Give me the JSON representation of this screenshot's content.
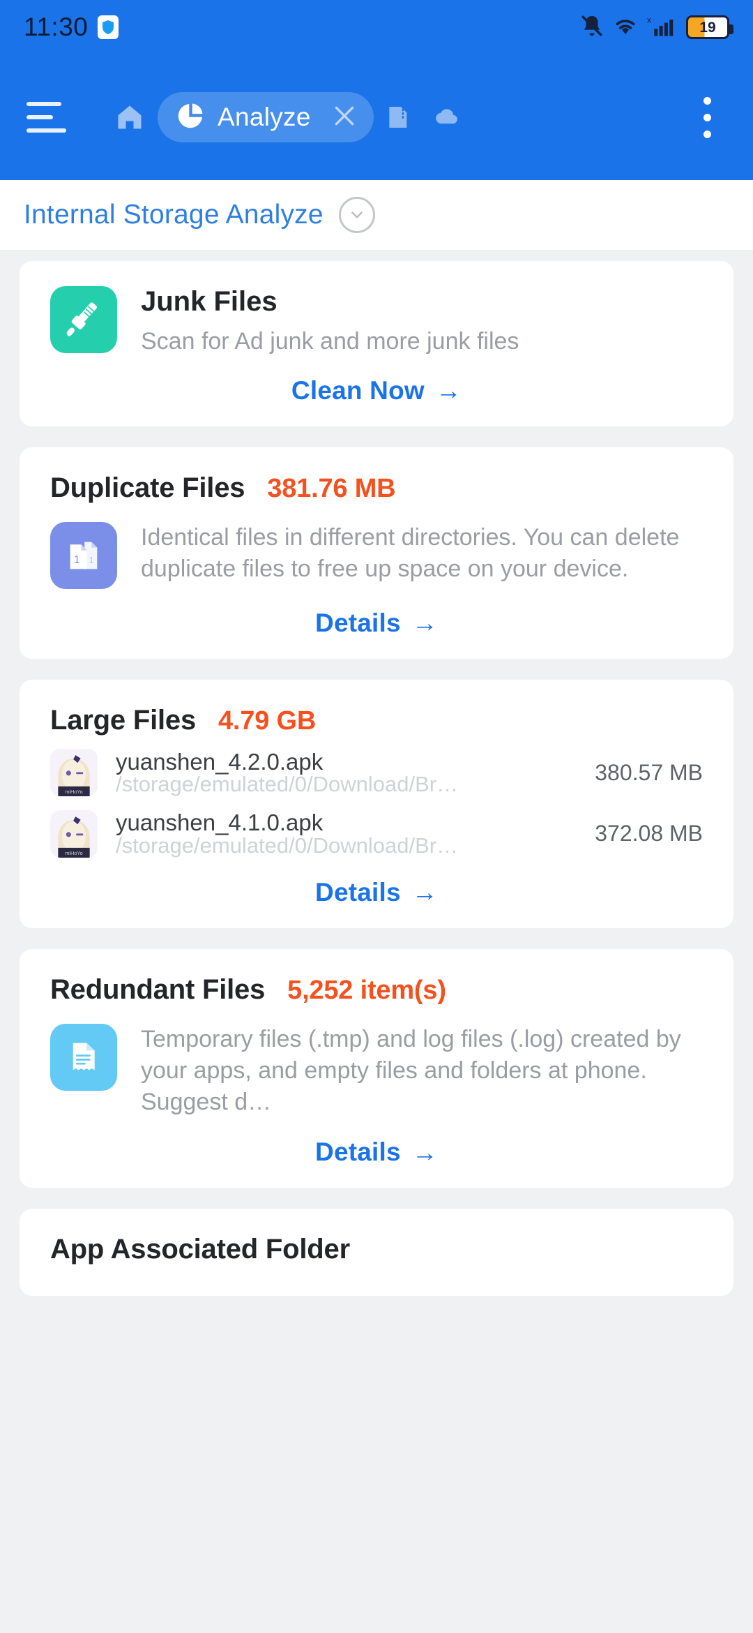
{
  "status_bar": {
    "time": "11:30",
    "left_icons": [
      "shield-icon"
    ],
    "right_icons": [
      "bell-muted-icon",
      "wifi-icon",
      "signal-x-icon"
    ],
    "battery_level": "19"
  },
  "toolbar": {
    "menu_icon": "hamburger-icon",
    "home_icon": "home-icon",
    "active_tab": {
      "icon": "pie-chart-icon",
      "label": "Analyze",
      "close_icon": "close-icon"
    },
    "sdcard_icon": "sdcard-icon",
    "cloud_icon": "cloud-icon",
    "overflow_icon": "kebab-menu-icon"
  },
  "path_bar": {
    "title": "Internal Storage Analyze",
    "expand_icon": "chevron-down-icon"
  },
  "cards": {
    "junk": {
      "icon": "broom-icon",
      "title": "Junk Files",
      "subtitle": "Scan for Ad junk and more junk files",
      "action_label": "Clean Now",
      "action_arrow": "→"
    },
    "duplicate": {
      "icon": "duplicate-files-icon",
      "title": "Duplicate Files",
      "amount": "381.76 MB",
      "description": "Identical files in different directories. You can delete duplicate files to free up space on your device.",
      "action_label": "Details",
      "action_arrow": "→"
    },
    "large": {
      "title": "Large Files",
      "amount": "4.79 GB",
      "files": [
        {
          "thumb": "genshin-apk-icon",
          "name": "yuanshen_4.2.0.apk",
          "path": "/storage/emulated/0/Download/Br…",
          "size": "380.57 MB"
        },
        {
          "thumb": "genshin-apk-icon",
          "name": "yuanshen_4.1.0.apk",
          "path": "/storage/emulated/0/Download/Br…",
          "size": "372.08 MB"
        }
      ],
      "action_label": "Details",
      "action_arrow": "→"
    },
    "redundant": {
      "icon": "document-receipt-icon",
      "title": "Redundant Files",
      "amount": "5,252 item(s)",
      "description": "Temporary files (.tmp) and log files (.log) created by your apps, and empty files and folders at phone. Suggest d…",
      "action_label": "Details",
      "action_arrow": "→"
    },
    "app_folder": {
      "title": "App Associated Folder"
    }
  },
  "colors": {
    "brand_blue": "#1a73e8",
    "accent_orange": "#f4511e",
    "link_blue": "#1a73e8",
    "junk_icon": "#25cfae",
    "duplicate_icon": "#7b8fe8",
    "redundant_icon": "#62caf5"
  }
}
